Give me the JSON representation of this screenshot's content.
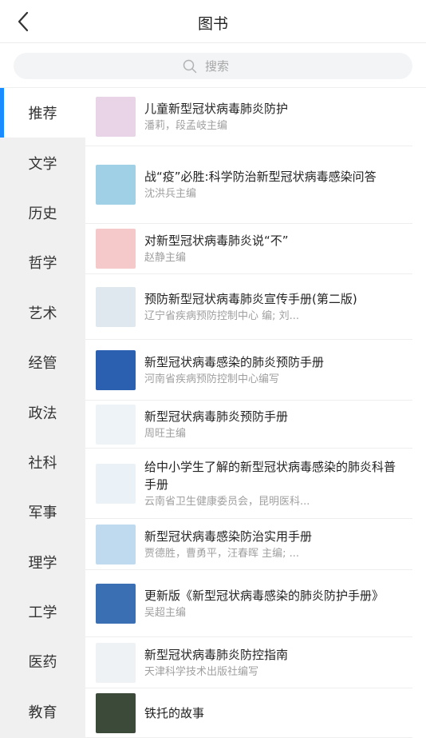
{
  "header": {
    "title": "图书"
  },
  "search": {
    "placeholder": "搜索"
  },
  "sidebar": {
    "items": [
      {
        "label": "推荐",
        "active": true
      },
      {
        "label": "文学"
      },
      {
        "label": "历史"
      },
      {
        "label": "哲学"
      },
      {
        "label": "艺术"
      },
      {
        "label": "经管"
      },
      {
        "label": "政法"
      },
      {
        "label": "社科"
      },
      {
        "label": "军事"
      },
      {
        "label": "理学"
      },
      {
        "label": "工学"
      },
      {
        "label": "医药"
      },
      {
        "label": "教育"
      }
    ]
  },
  "books": [
    {
      "title": "儿童新型冠状病毒肺炎防护",
      "author": "潘莉，段孟岐主编",
      "cover_color": "#e9d3e6"
    },
    {
      "title": "战“疫”必胜:科学防治新型冠状病毒感染问答",
      "author": "沈洪兵主编",
      "cover_color": "#9fd0e6"
    },
    {
      "title": "对新型冠状病毒肺炎说“不”",
      "author": "赵静主编",
      "cover_color": "#f5c9c9"
    },
    {
      "title": "预防新型冠状病毒肺炎宣传手册(第二版)",
      "author": "辽宁省疾病预防控制中心 编; 刘...",
      "cover_color": "#dfe7ef"
    },
    {
      "title": "新型冠状病毒感染的肺炎预防手册",
      "author": "河南省疾病预防控制中心编写",
      "cover_color": "#2b5fb0"
    },
    {
      "title": "新型冠状病毒肺炎预防手册",
      "author": "周旺主编",
      "cover_color": "#eef3f8"
    },
    {
      "title": "给中小学生了解的新型冠状病毒感染的肺炎科普手册",
      "author": "云南省卫生健康委员会，昆明医科...",
      "cover_color": "#eaf2f8"
    },
    {
      "title": "新型冠状病毒感染防治实用手册",
      "author": "贾德胜，曹勇平，汪春晖 主编; ...",
      "cover_color": "#bfd9ef"
    },
    {
      "title": "更新版《新型冠状病毒感染的肺炎防护手册》",
      "author": "吴超主编",
      "cover_color": "#3a6fb3"
    },
    {
      "title": "新型冠状病毒肺炎防控指南",
      "author": "天津科学技术出版社编写",
      "cover_color": "#eef2f5"
    },
    {
      "title": "铁托的故事",
      "author": "",
      "cover_color": "#3c4a3a"
    }
  ],
  "icons": {
    "back": "chevron-left-icon",
    "search": "search-icon"
  },
  "colors": {
    "accent": "#1a8cff"
  }
}
